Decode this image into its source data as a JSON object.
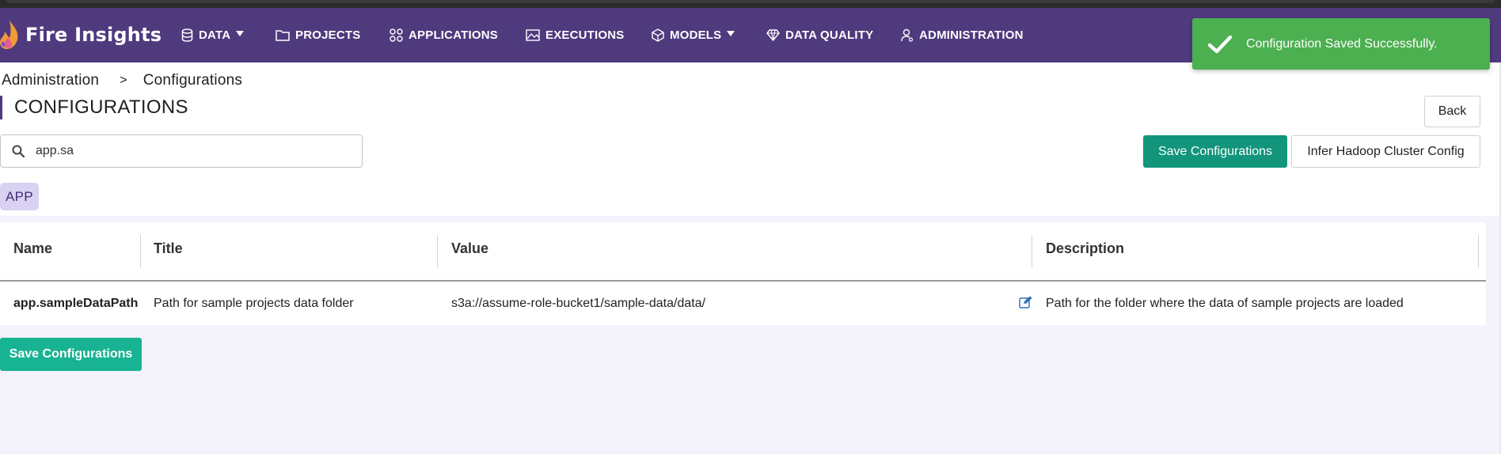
{
  "app": {
    "title": "Fire Insights"
  },
  "nav": {
    "items": [
      {
        "label": "DATA",
        "icon": "database-icon",
        "has_caret": true
      },
      {
        "label": "PROJECTS",
        "icon": "folder-icon",
        "has_caret": false
      },
      {
        "label": "APPLICATIONS",
        "icon": "grid-icon",
        "has_caret": false
      },
      {
        "label": "EXECUTIONS",
        "icon": "image-chart-icon",
        "has_caret": false
      },
      {
        "label": "MODELS",
        "icon": "cube-icon",
        "has_caret": true
      },
      {
        "label": "DATA QUALITY",
        "icon": "diamond-icon",
        "has_caret": false
      },
      {
        "label": "ADMINISTRATION",
        "icon": "user-gear-icon",
        "has_caret": false
      }
    ]
  },
  "toast": {
    "message": "Configuration Saved Successfully.",
    "color": "#4caf50"
  },
  "breadcrumb": {
    "parent": "Administration",
    "separator": ">",
    "current": "Configurations"
  },
  "page": {
    "title": "CONFIGURATIONS"
  },
  "buttons": {
    "back": "Back",
    "save_configurations": "Save Configurations",
    "infer_hadoop": "Infer Hadoop Cluster Config"
  },
  "search": {
    "value": "app.sa",
    "placeholder": ""
  },
  "category_chip": "APP",
  "table": {
    "columns": [
      "Name",
      "Title",
      "Value",
      "Description"
    ],
    "rows": [
      {
        "name": "app.sampleDataPath",
        "title": "Path for sample projects data folder",
        "value": "s3a://assume-role-bucket1/sample-data/data/",
        "description": "Path for the folder where the data of sample projects are loaded"
      }
    ]
  },
  "colors": {
    "navbar": "#4f3a7e",
    "primary_button": "#12957a",
    "bottom_button": "#18b392",
    "chip": "#d9d2f3"
  }
}
